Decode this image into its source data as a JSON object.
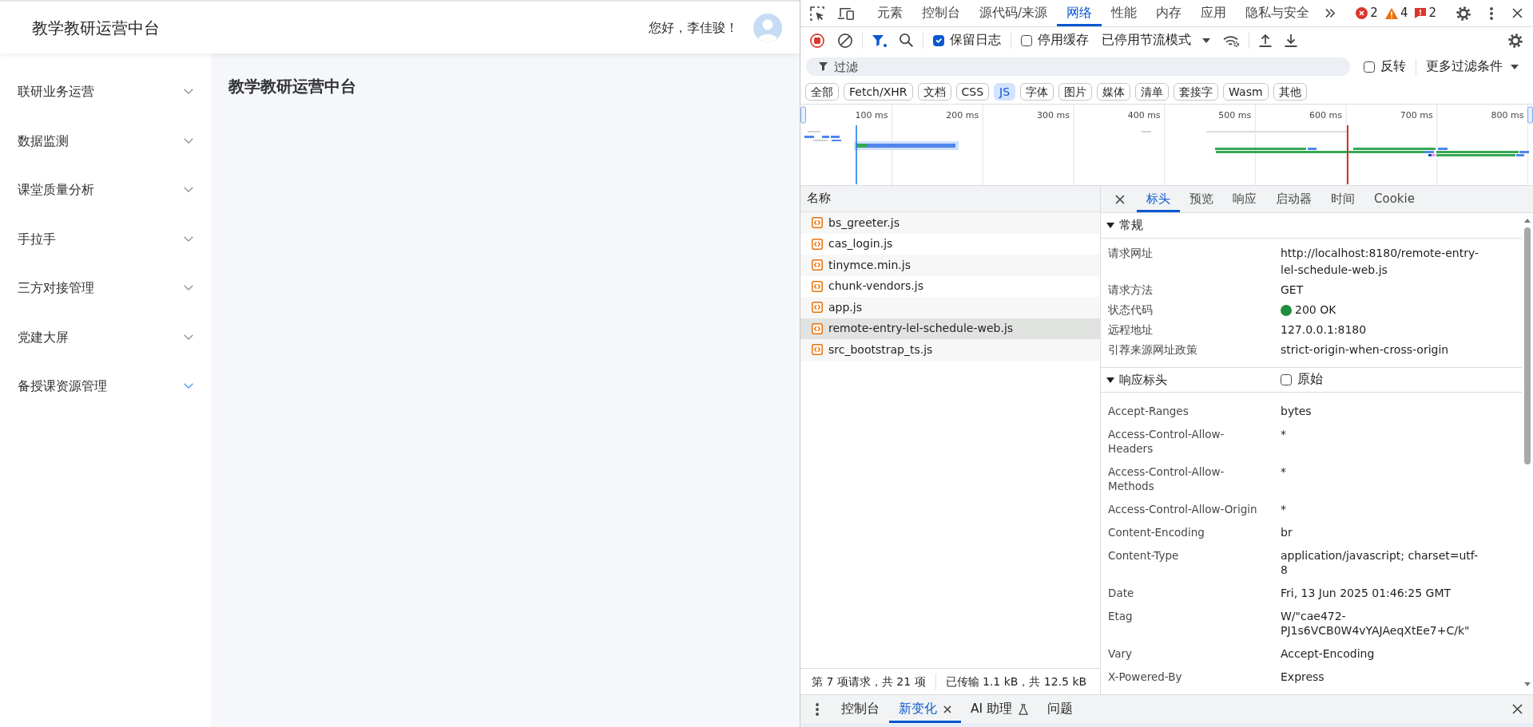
{
  "app": {
    "header": {
      "title": "教学教研运营中台",
      "greeting": "您好，李佳骏！"
    },
    "sidebar": {
      "items": [
        {
          "label": "联研业务运营",
          "selected": false
        },
        {
          "label": "数据监测",
          "selected": false
        },
        {
          "label": "课堂质量分析",
          "selected": false
        },
        {
          "label": "手拉手",
          "selected": false
        },
        {
          "label": "三方对接管理",
          "selected": false
        },
        {
          "label": "党建大屏",
          "selected": false
        },
        {
          "label": "备授课资源管理",
          "selected": true
        }
      ]
    },
    "content": {
      "title": "教学教研运营中台"
    }
  },
  "devtools": {
    "tabs": [
      {
        "label": "元素",
        "selected": false
      },
      {
        "label": "控制台",
        "selected": false
      },
      {
        "label": "源代码/来源",
        "selected": false
      },
      {
        "label": "网络",
        "selected": true
      },
      {
        "label": "性能",
        "selected": false
      },
      {
        "label": "内存",
        "selected": false
      },
      {
        "label": "应用",
        "selected": false
      },
      {
        "label": "隐私与安全",
        "selected": false
      }
    ],
    "counters": [
      {
        "kind": "error",
        "count": "2"
      },
      {
        "kind": "warning",
        "count": "4"
      },
      {
        "kind": "issue",
        "count": "2"
      }
    ],
    "toolbar": {
      "options": [
        {
          "label": "保留日志",
          "checked": true
        },
        {
          "label": "停用缓存",
          "checked": false
        }
      ],
      "throttling": "已停用节流模式"
    },
    "filter": {
      "placeholder": "过滤",
      "invert": {
        "label": "反转",
        "checked": false
      },
      "more_filters": "更多过滤条件"
    },
    "type_filters": [
      {
        "label": "全部",
        "selected": false
      },
      {
        "label": "Fetch/XHR",
        "selected": false
      },
      {
        "label": "文档",
        "selected": false
      },
      {
        "label": "CSS",
        "selected": false
      },
      {
        "label": "JS",
        "selected": true
      },
      {
        "label": "字体",
        "selected": false
      },
      {
        "label": "图片",
        "selected": false
      },
      {
        "label": "媒体",
        "selected": false
      },
      {
        "label": "清单",
        "selected": false
      },
      {
        "label": "套接字",
        "selected": false
      },
      {
        "label": "Wasm",
        "selected": false
      },
      {
        "label": "其他",
        "selected": false
      }
    ],
    "overview": {
      "ticks": [
        "100 ms",
        "200 ms",
        "300 ms",
        "400 ms",
        "500 ms",
        "600 ms",
        "700 ms",
        "800 ms"
      ]
    },
    "requests": {
      "column": "名称",
      "rows": [
        {
          "name": "bs_greeter.js",
          "selected": false
        },
        {
          "name": "cas_login.js",
          "selected": false
        },
        {
          "name": "tinymce.min.js",
          "selected": false
        },
        {
          "name": "chunk-vendors.js",
          "selected": false
        },
        {
          "name": "app.js",
          "selected": false
        },
        {
          "name": "remote-entry-lel-schedule-web.js",
          "selected": true
        },
        {
          "name": "src_bootstrap_ts.js",
          "selected": false
        }
      ],
      "summary": "第 7 项请求，共 21 项",
      "transferred": "已传输 1.1 kB，共 12.5 kB"
    },
    "details": {
      "tabs": [
        {
          "label": "标头",
          "selected": true
        },
        {
          "label": "预览",
          "selected": false
        },
        {
          "label": "响应",
          "selected": false
        },
        {
          "label": "启动器",
          "selected": false
        },
        {
          "label": "时间",
          "selected": false
        },
        {
          "label": "Cookie",
          "selected": false
        }
      ],
      "sections": [
        {
          "title": "常规",
          "expanded": true,
          "rows": [
            {
              "kind": "text",
              "name": "请求网址",
              "value": "http://localhost:8180/remote-entry-lel-schedule-web.js"
            },
            {
              "kind": "text",
              "name": "请求方法",
              "value": "GET"
            },
            {
              "kind": "status",
              "name": "状态代码",
              "value": "200 OK"
            },
            {
              "kind": "text",
              "name": "远程地址",
              "value": "127.0.0.1:8180"
            },
            {
              "kind": "text",
              "name": "引荐来源网址政策",
              "value": "strict-origin-when-cross-origin"
            }
          ]
        },
        {
          "title": "响应标头",
          "expanded": true,
          "raw": {
            "label": "原始",
            "checked": false
          },
          "rows": [
            {
              "kind": "text",
              "name": "Accept-Ranges",
              "value": "bytes"
            },
            {
              "kind": "text",
              "name": "Access-Control-Allow-Headers",
              "value": "*"
            },
            {
              "kind": "text",
              "name": "Access-Control-Allow-Methods",
              "value": "*"
            },
            {
              "kind": "text",
              "name": "Access-Control-Allow-Origin",
              "value": "*"
            },
            {
              "kind": "text",
              "name": "Content-Encoding",
              "value": "br"
            },
            {
              "kind": "text",
              "name": "Content-Type",
              "value": "application/javascript; charset=utf-8"
            },
            {
              "kind": "text",
              "name": "Date",
              "value": "Fri, 13 Jun 2025 01:46:25 GMT"
            },
            {
              "kind": "text",
              "name": "Etag",
              "value": "W/\"cae472-PJ1s6VCB0W4vYAJAeqXtEe7+C/k\""
            },
            {
              "kind": "text",
              "name": "Vary",
              "value": "Accept-Encoding"
            },
            {
              "kind": "text",
              "name": "X-Powered-By",
              "value": "Express"
            }
          ]
        }
      ]
    },
    "drawer": {
      "tabs": [
        {
          "label": "控制台",
          "selected": false,
          "closable": false,
          "experimental": false
        },
        {
          "label": "新变化",
          "selected": true,
          "closable": true,
          "experimental": false
        },
        {
          "label": "AI 助理",
          "selected": false,
          "closable": false,
          "experimental": true
        },
        {
          "label": "问题",
          "selected": false,
          "closable": false,
          "experimental": false
        }
      ]
    }
  }
}
